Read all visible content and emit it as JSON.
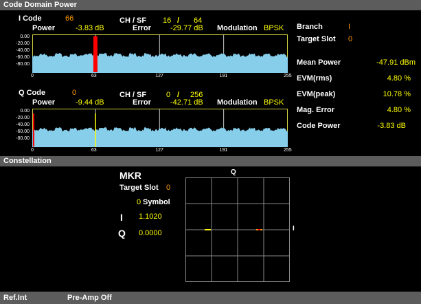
{
  "panels": {
    "cdp_title": "Code Domain Power",
    "constellation_title": "Constellation"
  },
  "i_channel": {
    "code_label": "I Code",
    "code_value": "66",
    "power_label": "Power",
    "power_value": "-3.83 dB",
    "chsf_label": "CH / SF",
    "ch_value": "16",
    "slash": "/",
    "sf_value": "64",
    "error_label": "Error",
    "error_value": "-29.77 dB",
    "mod_label": "Modulation",
    "mod_value": "BPSK"
  },
  "q_channel": {
    "code_label": "Q Code",
    "code_value": "0",
    "power_label": "Power",
    "power_value": "-9.44 dB",
    "chsf_label": "CH / SF",
    "ch_value": "0",
    "slash": "/",
    "sf_value": "256",
    "error_label": "Error",
    "error_value": "-42.71 dB",
    "mod_label": "Modulation",
    "mod_value": "BPSK"
  },
  "y_ticks": [
    "0.00",
    "-20.00",
    "-40.00",
    "-60.00",
    "-80.00"
  ],
  "x_ticks": [
    "0",
    "63",
    "127",
    "191",
    "255"
  ],
  "i_chart": {
    "baseline_db": -45,
    "ymin": -80,
    "ymax": 0,
    "marker_code": 63,
    "marker_db": -3.83,
    "highlight_code": 63,
    "highlight_color": "#ff0000"
  },
  "q_chart": {
    "baseline_db": -45,
    "ymin": -80,
    "ymax": 0,
    "marker_code": 63,
    "marker_db": -9.44,
    "highlight_code": 0,
    "highlight_color": "#ff0000",
    "marker_color": "#ffff00"
  },
  "results": {
    "branch_label": "Branch",
    "branch_value": "I",
    "slot_label": "Target Slot",
    "slot_value": "0",
    "mean_power_label": "Mean Power",
    "mean_power_value": "-47.91 dBm",
    "evm_rms_label": "EVM(rms)",
    "evm_rms_value": "4.80 %",
    "evm_peak_label": "EVM(peak)",
    "evm_peak_value": "10.78 %",
    "mag_error_label": "Mag. Error",
    "mag_error_value": "4.80 %",
    "code_power_label": "Code Power",
    "code_power_value": "-3.83 dB"
  },
  "marker": {
    "title": "MKR",
    "slot_label": "Target Slot",
    "slot_value": "0",
    "symbol_value": "0",
    "symbol_label": "Symbol",
    "i_label": "I",
    "i_value": "1.1020",
    "q_label": "Q",
    "q_value": "0.0000"
  },
  "constellation": {
    "q_axis_label": "Q",
    "i_axis_label": "I"
  },
  "status_bar": {
    "ref": "Ref.Int",
    "preamp": "Pre-Amp Off"
  },
  "colors": {
    "trace": "#87ceeb",
    "grid": "#d0d040",
    "header": "#5c5c5c"
  }
}
